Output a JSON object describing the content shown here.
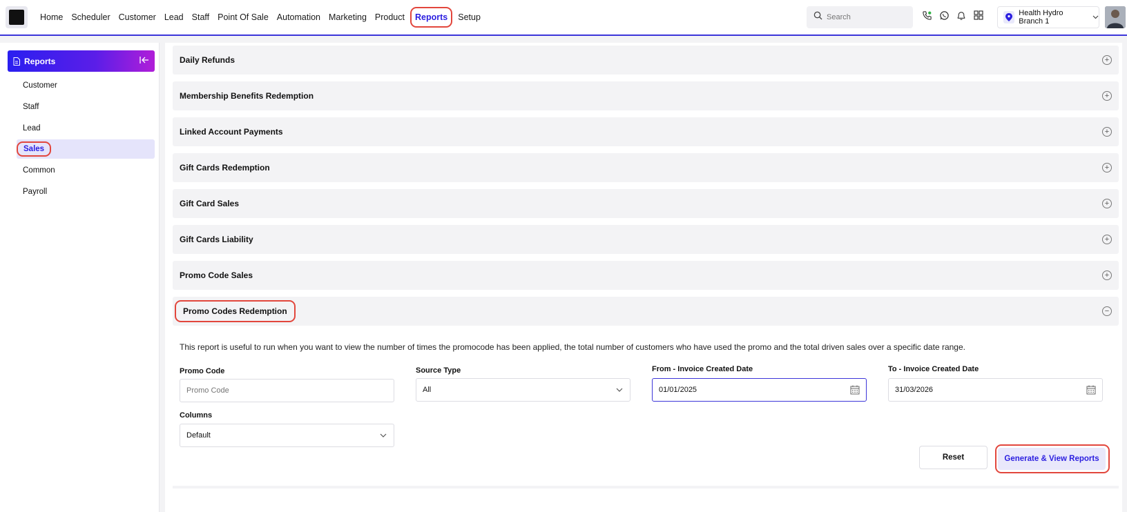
{
  "nav": {
    "items": [
      "Home",
      "Scheduler",
      "Customer",
      "Lead",
      "Staff",
      "Point Of Sale",
      "Automation",
      "Marketing",
      "Product",
      "Reports",
      "Setup"
    ],
    "active": "Reports"
  },
  "search": {
    "placeholder": "Search"
  },
  "branch": {
    "label": "Health Hydro Branch 1"
  },
  "sidebar": {
    "title": "Reports",
    "items": [
      "Customer",
      "Staff",
      "Lead",
      "Sales",
      "Common",
      "Payroll"
    ],
    "active": "Sales"
  },
  "accordion": {
    "items": [
      "Daily Refunds",
      "Membership Benefits Redemption",
      "Linked Account Payments",
      "Gift Cards Redemption",
      "Gift Card Sales",
      "Gift Cards Liability",
      "Promo Code Sales"
    ],
    "open_title": "Promo Codes Redemption"
  },
  "report": {
    "description": "This report is useful to run when you want to view the number of times the promocode has been applied, the total number of customers who have used the promo and the total driven sales over a specific date range.",
    "promo_code": {
      "label": "Promo Code",
      "placeholder": "Promo Code",
      "value": ""
    },
    "source_type": {
      "label": "Source Type",
      "value": "All"
    },
    "from_date": {
      "label": "From - Invoice Created Date",
      "value": "01/01/2025"
    },
    "to_date": {
      "label": "To - Invoice Created Date",
      "value": "31/03/2026"
    },
    "columns": {
      "label": "Columns",
      "value": "Default"
    },
    "reset_label": "Reset",
    "generate_label": "Generate & View Reports"
  },
  "colors": {
    "accent": "#2b1ee0",
    "highlight": "#e2463c",
    "panel": "#f3f3f5"
  }
}
